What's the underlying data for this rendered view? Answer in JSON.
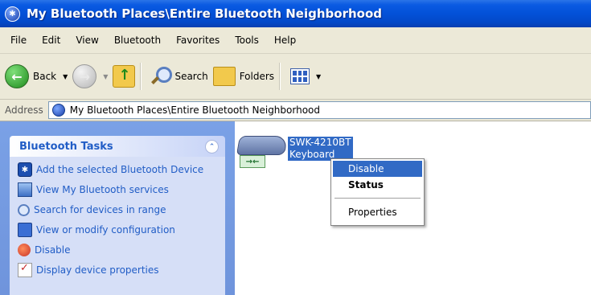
{
  "window": {
    "title": "My Bluetooth Places\\Entire Bluetooth Neighborhood"
  },
  "menubar": {
    "items": [
      "File",
      "Edit",
      "View",
      "Bluetooth",
      "Favorites",
      "Tools",
      "Help"
    ]
  },
  "toolbar": {
    "back_label": "Back",
    "search_label": "Search",
    "folders_label": "Folders"
  },
  "address": {
    "label": "Address",
    "value": "My Bluetooth Places\\Entire Bluetooth Neighborhood"
  },
  "tasks": {
    "title": "Bluetooth Tasks",
    "items": [
      {
        "label": "Add the selected Bluetooth Device",
        "icon": "bluetooth-icon"
      },
      {
        "label": "View My Bluetooth services",
        "icon": "services-icon"
      },
      {
        "label": "Search for devices in range",
        "icon": "search-icon"
      },
      {
        "label": "View or modify configuration",
        "icon": "config-icon"
      },
      {
        "label": "Disable",
        "icon": "disable-icon"
      },
      {
        "label": "Display device properties",
        "icon": "properties-icon"
      }
    ]
  },
  "device": {
    "name": "SWK-4210BT",
    "type": "Keyboard"
  },
  "context_menu": {
    "items": [
      {
        "label": "Disable",
        "highlighted": true
      },
      {
        "label": "Status",
        "bold": true
      },
      {
        "label": "Properties"
      }
    ]
  },
  "colors": {
    "title_bar": "#0351d8",
    "task_pane": "#7aa1e6",
    "selection": "#316ac5",
    "link": "#215dc6"
  }
}
